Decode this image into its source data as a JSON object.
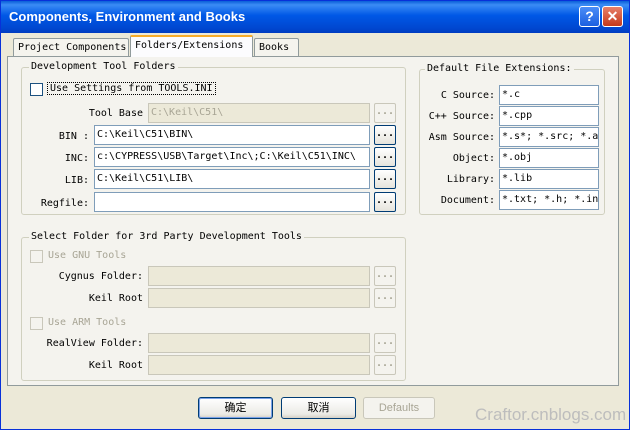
{
  "window": {
    "title": "Components, Environment and Books",
    "help_label": "?",
    "close_label": "✕"
  },
  "tabs": [
    {
      "label": "Project Components"
    },
    {
      "label": "Folders/Extensions"
    },
    {
      "label": "Books"
    }
  ],
  "dev_tool": {
    "legend": "Development Tool Folders",
    "use_settings_label": "Use Settings from TOOLS.INI",
    "tool_base_label": "Tool Base",
    "tool_base_value": "C:\\Keil\\C51\\",
    "bin_label": "BIN :",
    "bin_value": "C:\\Keil\\C51\\BIN\\",
    "inc_label": "INC:",
    "inc_value": "c:\\CYPRESS\\USB\\Target\\Inc\\;C:\\Keil\\C51\\INC\\",
    "lib_label": "LIB:",
    "lib_value": "C:\\Keil\\C51\\LIB\\",
    "regfile_label": "Regfile:",
    "regfile_value": "",
    "browse_label": "..."
  },
  "extensions": {
    "legend": "Default File Extensions:",
    "rows": [
      {
        "label": "C Source:",
        "value": "*.c"
      },
      {
        "label": "C++ Source:",
        "value": "*.cpp"
      },
      {
        "label": "Asm Source:",
        "value": "*.s*; *.src; *.a"
      },
      {
        "label": "Object:",
        "value": "*.obj"
      },
      {
        "label": "Library:",
        "value": "*.lib"
      },
      {
        "label": "Document:",
        "value": "*.txt; *.h; *.in"
      }
    ]
  },
  "third_party": {
    "legend": "Select Folder for 3rd Party Development Tools",
    "gnu_label": "Use GNU Tools",
    "cygnus_label": "Cygnus Folder:",
    "keil_root_label": "Keil Root",
    "arm_label": "Use ARM Tools",
    "realview_label": "RealView Folder:",
    "keil_root2_label": "Keil Root"
  },
  "buttons": {
    "ok": "确定",
    "cancel": "取消",
    "defaults": "Defaults"
  },
  "watermark": "Craftor.cnblogs.com"
}
